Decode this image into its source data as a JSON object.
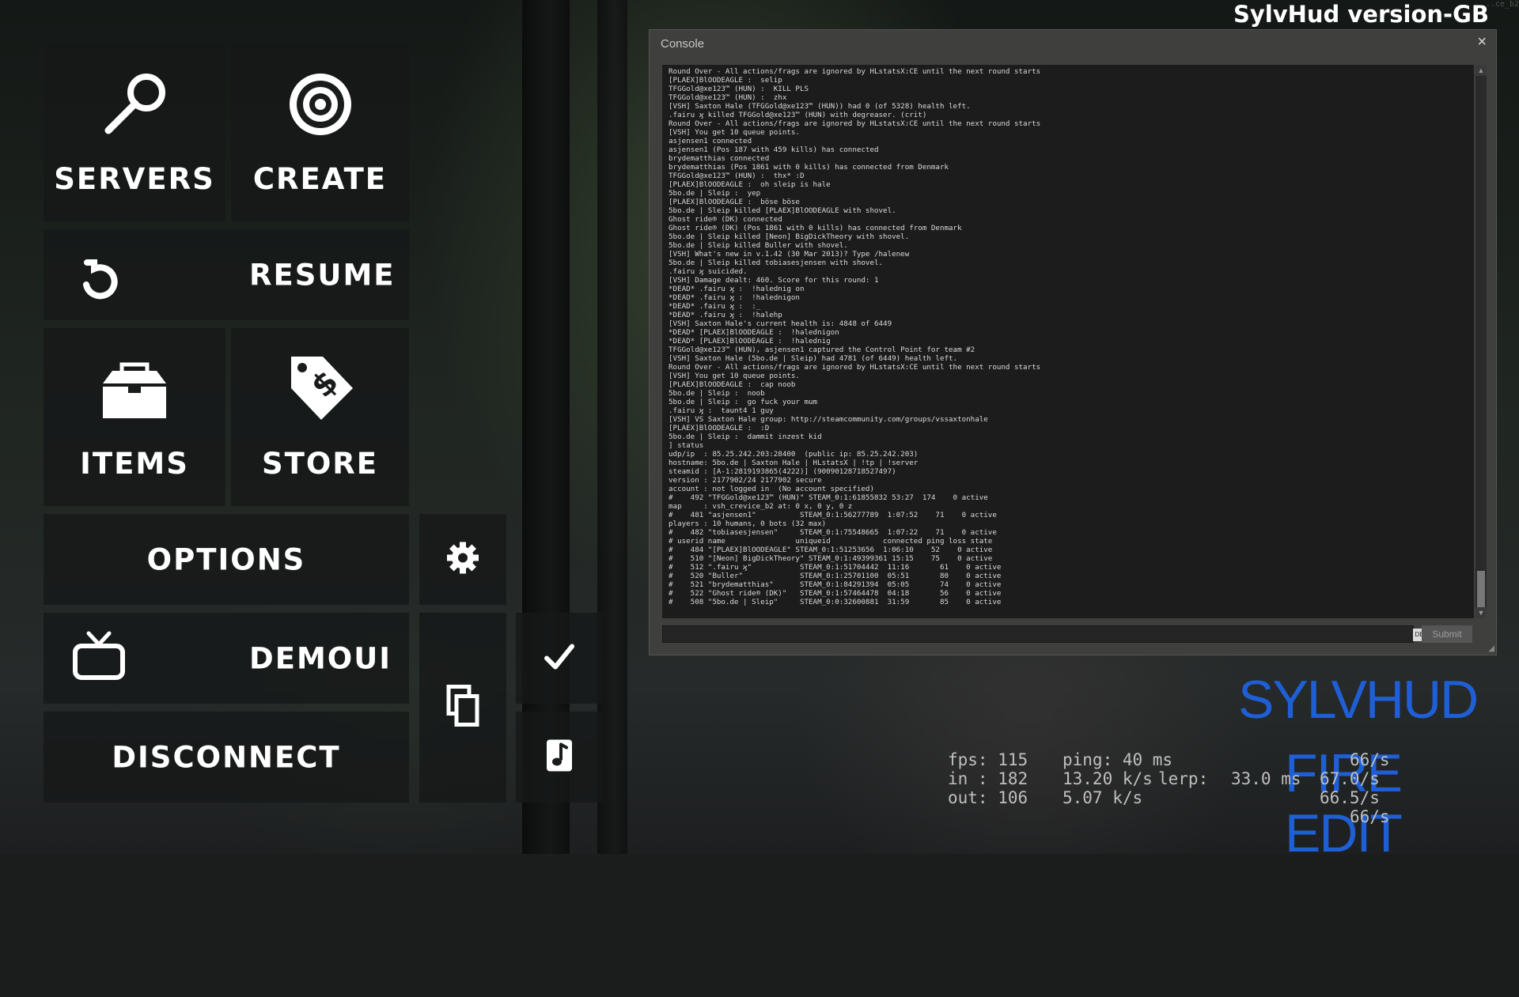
{
  "hud_version": "SylvHud version-GB",
  "top_right_faint": "...ce_b2",
  "menu": {
    "servers": "SERVERS",
    "create": "CREATE",
    "resume": "RESUME",
    "items": "ITEMS",
    "store": "STORE",
    "options": "OPTIONS",
    "demoui": "DEMOUI",
    "disconnect": "DISCONNECT"
  },
  "console": {
    "title": "Console",
    "close": "×",
    "lang_indicator": "DE",
    "submit_label": "Submit",
    "input_value": "",
    "lines": [
      "Round Over - All actions/frags are ignored by HLstatsX:CE until the next round starts",
      "[PLAEX]BlOODEAGLE :  selip",
      "TFGGold@xe123™ (HUN) :  KILL PLS",
      "TFGGold@xe123™ (HUN) :  zhx",
      "[VSH] Saxton Hale (TFGGold@xe123™ (HUN)) had 0 (of 5328) health left.",
      ".fairu ϗ killed TFGGold@xe123™ (HUN) with degreaser. (crit)",
      "Round Over - All actions/frags are ignored by HLstatsX:CE until the next round starts",
      "[VSH] You get 10 queue points.",
      "asjensen1 connected",
      "asjensen1 (Pos 187 with 459 kills) has connected",
      "brydematthias connected",
      "brydematthias (Pos 1861 with 0 kills) has connected from Denmark",
      "TFGGold@xe123™ (HUN) :  thx* :D",
      "[PLAEX]BlOODEAGLE :  oh sleip is hale",
      "5bo.de | Sleip :  yep",
      "[PLAEX]BlOODEAGLE :  böse böse",
      "5bo.de | Sleip killed [PLAEX]BlOODEAGLE with shovel.",
      "Ghost ride® (DK) connected",
      "Ghost ride® (DK) (Pos 1861 with 0 kills) has connected from Denmark",
      "5bo.de | Sleip killed [Neon] BigDickTheory with shovel.",
      "5bo.de | Sleip killed Buller with shovel.",
      "[VSH] What's new in v.1.42 (30 Mar 2013)? Type /halenew",
      "5bo.de | Sleip killed tobiasesjensen with shovel.",
      ".fairu ϗ suicided.",
      "[VSH] Damage dealt: 460. Score for this round: 1",
      "*DEAD* .fairu ϗ :  !halednig on",
      "*DEAD* .fairu ϗ :  !halednigon",
      "*DEAD* .fairu ϗ :  :_",
      "*DEAD* .fairu ϗ :  !halehp",
      "[VSH] Saxton Hale's current health is: 4848 of 6449",
      "*DEAD* [PLAEX]BlOODEAGLE :  !halednigon",
      "*DEAD* [PLAEX]BlOODEAGLE :  !halednig",
      "TFGGold@xe123™ (HUN), asjensen1 captured the Control Point for team #2",
      "[VSH] Saxton Hale (5bo.de | Sleip) had 4781 (of 6449) health left.",
      "Round Over - All actions/frags are ignored by HLstatsX:CE until the next round starts",
      "[VSH] You get 10 queue points.",
      "[PLAEX]BlOODEAGLE :  cap noob",
      "5bo.de | Sleip :  noob",
      "5bo.de | Sleip :  go fuck your mum",
      ".fairu ϗ :  taunt4 1 guy",
      "[VSH] VS Saxton Hale group: http://steamcommunity.com/groups/vssaxtonhale",
      "[PLAEX]BlOODEAGLE :  :D",
      "5bo.de | Sleip :  dammit inzest kid",
      "] status",
      "udp/ip  : 85.25.242.203:28400  (public ip: 85.25.242.203)",
      "hostname: 5bo.de | Saxton Hale | HLstatsX | !tp | !server",
      "steamid : [A-1:2819193865(4222)] (90090128718527497)",
      "version : 2177902/24 2177902 secure",
      "account : not logged in  (No account specified)",
      "#    492 \"TFGGold@xe123™ (HUN)\" STEAM_0:1:61855832 53:27  174    0 active",
      "map     : vsh_crevice_b2 at: 0 x, 0 y, 0 z",
      "#    481 \"asjensen1\"          STEAM_0:1:56277789  1:07:52    71    0 active",
      "players : 10 humans, 0 bots (32 max)",
      "#    482 \"tobiasesjensen\"     STEAM_0:1:75548665  1:07:22    71    0 active",
      "# userid name                uniqueid            connected ping loss state",
      "#    484 \"[PLAEX]BlOODEAGLE\" STEAM_0:1:51253656  1:06:10    52    0 active",
      "#    510 \"[Neon] BigDickTheory\" STEAM_0:1:49399361 15:15    75    0 active",
      "#    512 \".fairu ϗ\"           STEAM_0:1:51704442  11:16       61    0 active",
      "#    520 \"Buller\"             STEAM_0:1:25701100  05:51       80    0 active",
      "#    521 \"brydematthias\"      STEAM_0:1:84291394  05:05       74    0 active",
      "#    522 \"Ghost ride® (DK)\"   STEAM_0:1:57464478  04:18       56    0 active",
      "#    508 \"5bo.de | Sleip\"     STEAM_0:0:32600881  31:59       85    0 active"
    ]
  },
  "logo": {
    "line1": "SYLVHUD",
    "line2": "FIRE EDIT"
  },
  "netgraph": {
    "fps": "fps: 115",
    "ping": "ping: 40 ms",
    "in": "in : 182",
    "in_rate": "13.20 k/s",
    "lerp": "lerp:",
    "lerp_val": "33.0 ms",
    "out": "out: 106",
    "out_rate": "5.07 k/s",
    "r1": "66/s",
    "r2": "67.0/s",
    "r3": "66.5/s",
    "r4": "66/s"
  }
}
